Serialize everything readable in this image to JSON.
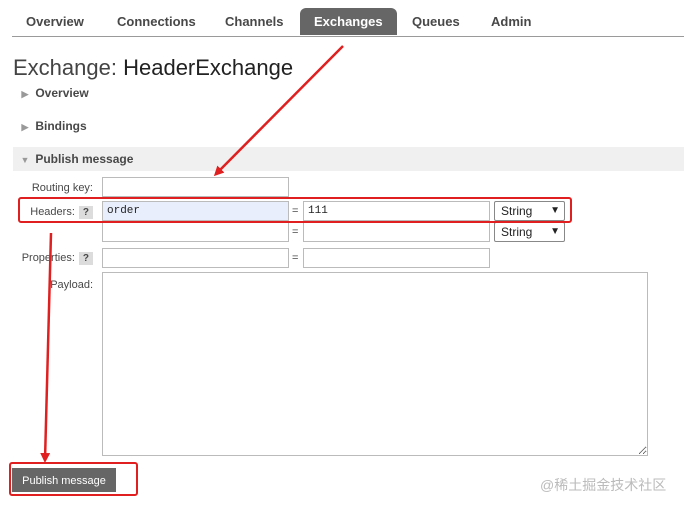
{
  "nav": {
    "tabs": [
      {
        "label": "Overview",
        "active": false
      },
      {
        "label": "Connections",
        "active": false
      },
      {
        "label": "Channels",
        "active": false
      },
      {
        "label": "Exchanges",
        "active": true
      },
      {
        "label": "Queues",
        "active": false
      },
      {
        "label": "Admin",
        "active": false
      }
    ]
  },
  "page": {
    "title_prefix": "Exchange:",
    "title_name": "HeaderExchange"
  },
  "sections": {
    "overview": "Overview",
    "bindings": "Bindings",
    "publish": "Publish message"
  },
  "form": {
    "routing_key_label": "Routing key:",
    "routing_key_value": "",
    "headers_label": "Headers:",
    "help": "?",
    "headers": [
      {
        "key": "order",
        "value": "111",
        "type": "String"
      },
      {
        "key": "",
        "value": "",
        "type": "String"
      }
    ],
    "equals": "=",
    "properties_label": "Properties:",
    "properties": [
      {
        "key": "",
        "value": ""
      }
    ],
    "payload_label": "Payload:",
    "payload_value": "",
    "publish_button": "Publish message"
  },
  "annotation": {
    "color": "#e02020"
  },
  "watermark": "@稀土掘金技术社区"
}
